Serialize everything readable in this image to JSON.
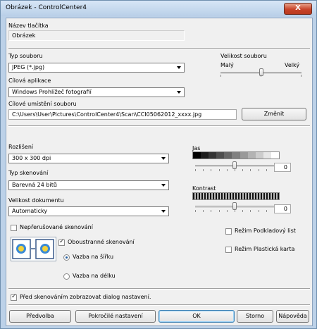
{
  "window": {
    "title": "Obrázek - ControlCenter4",
    "close": "X"
  },
  "button_name": {
    "label": "Název tlačítka",
    "value": "Obrázek"
  },
  "file_type": {
    "label": "Typ souboru",
    "value": "JPEG (*.jpg)"
  },
  "file_size": {
    "label": "Velikost souboru",
    "small": "Malý",
    "large": "Velký",
    "level": 0.5
  },
  "target_app": {
    "label": "Cílová aplikace",
    "value": "Windows Prohlížeč fotografií"
  },
  "target_location": {
    "label": "Cílové umístění souboru",
    "value": "C:\\Users\\User\\Pictures\\ControlCenter4\\Scan\\CCI05062012_xxxx.jpg",
    "change_button": "Změnit"
  },
  "resolution": {
    "label": "Rozlišení",
    "value": "300 x 300 dpi"
  },
  "scan_type": {
    "label": "Typ skenování",
    "value": "Barevná 24 bitů"
  },
  "doc_size": {
    "label": "Velikost dokumentu",
    "value": "Automaticky"
  },
  "brightness": {
    "label": "Jas",
    "value": "0",
    "level": 0.5
  },
  "contrast": {
    "label": "Kontrast",
    "value": "0",
    "level": 0.5
  },
  "continuous": {
    "label": "Nepřerušované skenování",
    "checked": false
  },
  "duplex": {
    "label": "Oboustranné skenování",
    "checked": true
  },
  "binding_long": {
    "label": "Vazba na šířku",
    "selected": true
  },
  "binding_short": {
    "label": "Vazba na délku",
    "selected": false
  },
  "carrier_sheet": {
    "label": "Režim Podkladový list",
    "checked": false
  },
  "plastic_card": {
    "label": "Režim Plastická karta",
    "checked": false
  },
  "show_dialog": {
    "label": "Před skenováním zobrazovat dialog nastavení.",
    "checked": true
  },
  "buttons": {
    "preview": "Předvolba",
    "advanced": "Pokročilé nastavení",
    "ok": "OK",
    "cancel": "Storno",
    "help": "Nápověda"
  },
  "colors": {
    "accent": "#1e5a9c",
    "titlebar": "#bcd1e8",
    "close": "#c8442a"
  }
}
